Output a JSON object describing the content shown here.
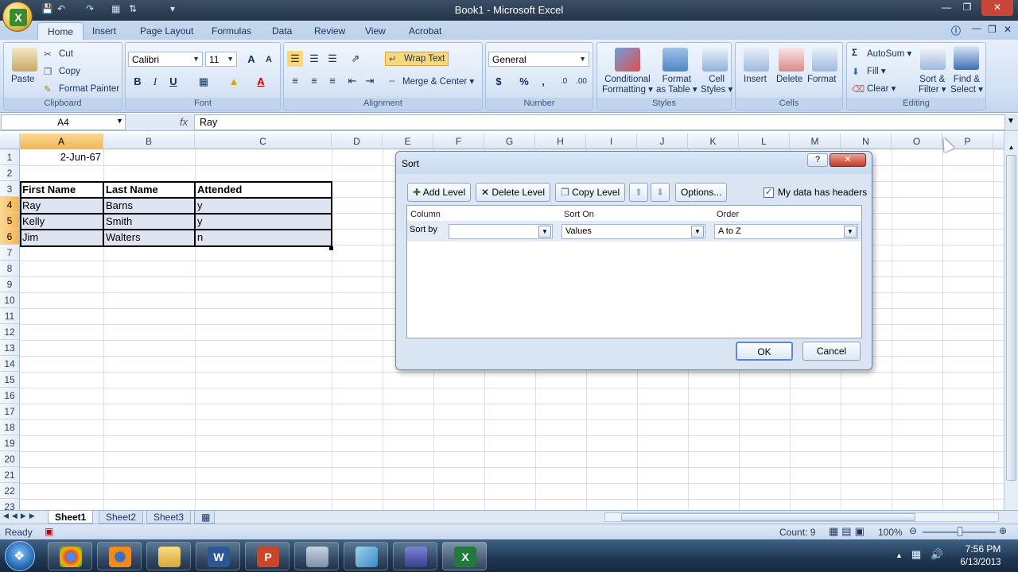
{
  "window": {
    "title": "Book1 - Microsoft Excel"
  },
  "tabs": [
    "Home",
    "Insert",
    "Page Layout",
    "Formulas",
    "Data",
    "Review",
    "View",
    "Acrobat"
  ],
  "ribbon": {
    "clipboard": {
      "label": "Clipboard",
      "paste": "Paste",
      "cut": "Cut",
      "copy": "Copy",
      "format_painter": "Format Painter"
    },
    "font": {
      "label": "Font",
      "family": "Calibri",
      "size": "11",
      "bold": "B",
      "italic": "I",
      "underline": "U"
    },
    "alignment": {
      "label": "Alignment",
      "wrap": "Wrap Text",
      "merge": "Merge & Center"
    },
    "number": {
      "label": "Number",
      "format": "General",
      "currency": "$",
      "percent": "%",
      "comma": ","
    },
    "styles": {
      "label": "Styles",
      "conditional": "Conditional",
      "conditional2": "Formatting",
      "format_table": "Format",
      "format_table2": "as Table",
      "cell_styles": "Cell",
      "cell_styles2": "Styles"
    },
    "cells": {
      "label": "Cells",
      "insert": "Insert",
      "delete": "Delete",
      "format": "Format"
    },
    "editing": {
      "label": "Editing",
      "autosum": "AutoSum",
      "fill": "Fill",
      "clear": "Clear",
      "sort": "Sort &",
      "sort2": "Filter",
      "find": "Find &",
      "find2": "Select"
    }
  },
  "formula_bar": {
    "name_box": "A4",
    "fx": "fx",
    "value": "Ray"
  },
  "columns": [
    "A",
    "B",
    "C",
    "D",
    "E",
    "F",
    "G",
    "H",
    "I",
    "J",
    "K",
    "L",
    "M",
    "N",
    "O",
    "P"
  ],
  "rows": [
    "1",
    "2",
    "3",
    "4",
    "5",
    "6",
    "7",
    "8",
    "9",
    "10",
    "11",
    "12",
    "13",
    "14",
    "15",
    "16",
    "17",
    "18",
    "19",
    "20",
    "21",
    "22",
    "23"
  ],
  "cells": {
    "A1": "2-Jun-67",
    "A3": "First Name",
    "B3": "Last Name",
    "C3": "Attended",
    "A4": "Ray",
    "B4": "Barns",
    "C4": "y",
    "A5": "Kelly",
    "B5": "Smith",
    "C5": "y",
    "A6": "Jim",
    "B6": "Walters",
    "C6": "n"
  },
  "sheets": [
    "Sheet1",
    "Sheet2",
    "Sheet3"
  ],
  "status": {
    "ready": "Ready",
    "count": "Count: 9",
    "zoom": "100%"
  },
  "taskbar": {
    "time": "7:56 PM",
    "date": "6/13/2013"
  },
  "dialog": {
    "title": "Sort",
    "help": "?",
    "close": "✕",
    "add_level": "Add Level",
    "delete_level": "Delete Level",
    "copy_level": "Copy Level",
    "options": "Options...",
    "headers_label": "My data has headers",
    "headers_checked": true,
    "col_header": "Column",
    "sorton_header": "Sort On",
    "order_header": "Order",
    "sort_by": "Sort by",
    "sort_by_value": "",
    "sort_on_value": "Values",
    "order_value": "A to Z",
    "ok": "OK",
    "cancel": "Cancel"
  }
}
